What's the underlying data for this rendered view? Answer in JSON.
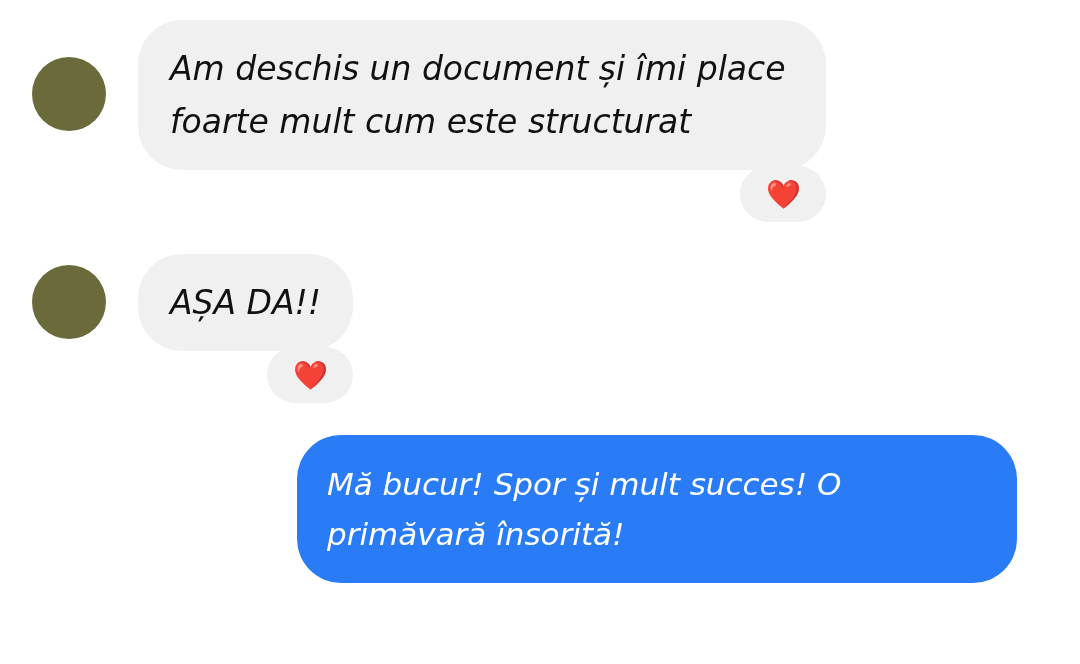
{
  "messages": [
    {
      "kind": "incoming",
      "text": "Am deschis un document și îmi place foarte mult cum este structurat",
      "reaction": "❤️"
    },
    {
      "kind": "incoming",
      "text": "AȘA DA!!",
      "reaction": "❤️"
    },
    {
      "kind": "outgoing",
      "text": "Mă bucur!  Spor și mult succes! O primăvară însorită!"
    }
  ]
}
